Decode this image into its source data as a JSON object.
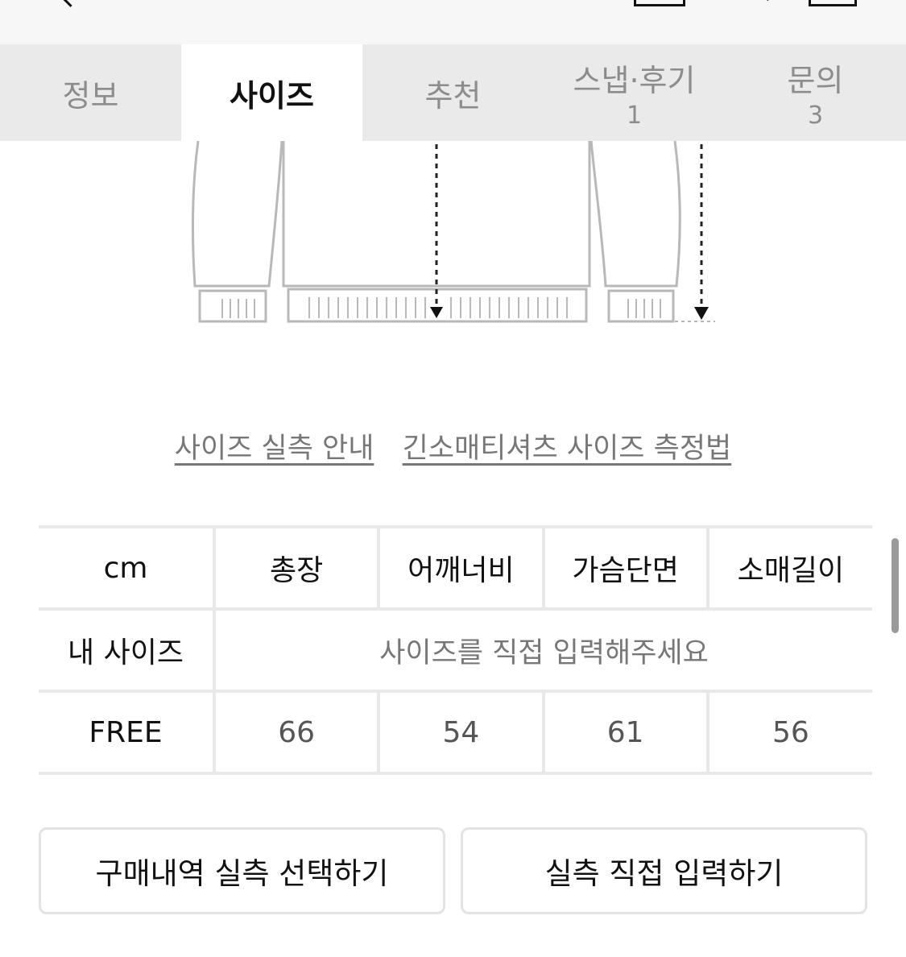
{
  "tabs": [
    {
      "label": "정보",
      "count": ""
    },
    {
      "label": "사이즈",
      "count": ""
    },
    {
      "label": "추천",
      "count": ""
    },
    {
      "label": "스냅·후기",
      "count": "1"
    },
    {
      "label": "문의",
      "count": "3"
    }
  ],
  "active_tab": 1,
  "guide_links": {
    "size_info": "사이즈 실측 안내",
    "measure_method": "긴소매티셔츠 사이즈 측정법"
  },
  "size_table": {
    "unit": "cm",
    "columns": [
      "총장",
      "어깨너비",
      "가슴단면",
      "소매길이"
    ],
    "my_size_label": "내 사이즈",
    "my_size_placeholder": "사이즈를 직접 입력해주세요",
    "rows": [
      {
        "size": "FREE",
        "values": [
          "66",
          "54",
          "61",
          "56"
        ]
      }
    ]
  },
  "buttons": {
    "history": "구매내역 실측 선택하기",
    "direct": "실측 직접 입력하기"
  },
  "icons": {
    "back": "chevron-left-icon",
    "home": "home-icon",
    "search": "search-icon",
    "cart": "cart-icon"
  }
}
